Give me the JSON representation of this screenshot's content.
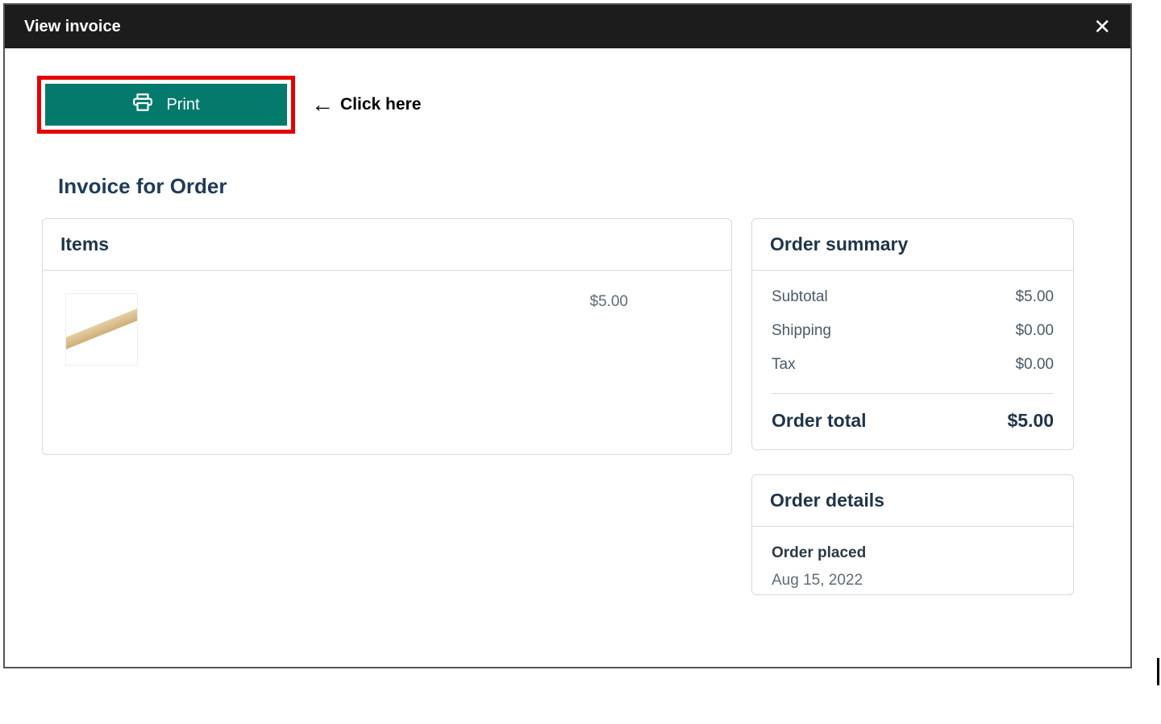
{
  "header": {
    "title": "View invoice",
    "close_glyph": "✕"
  },
  "toolbar": {
    "print_label": "Print"
  },
  "annotation": {
    "arrow_glyph": "←",
    "text": "Click here"
  },
  "page": {
    "title": "Invoice for Order"
  },
  "items_card": {
    "title": "Items",
    "rows": [
      {
        "price": "$5.00"
      }
    ]
  },
  "summary_card": {
    "title": "Order summary",
    "lines": [
      {
        "label": "Subtotal",
        "value": "$5.00"
      },
      {
        "label": "Shipping",
        "value": "$0.00"
      },
      {
        "label": "Tax",
        "value": "$0.00"
      }
    ],
    "total_label": "Order total",
    "total_value": "$5.00"
  },
  "details_card": {
    "title": "Order details",
    "placed_label": "Order placed",
    "placed_value": "Aug 15, 2022"
  }
}
